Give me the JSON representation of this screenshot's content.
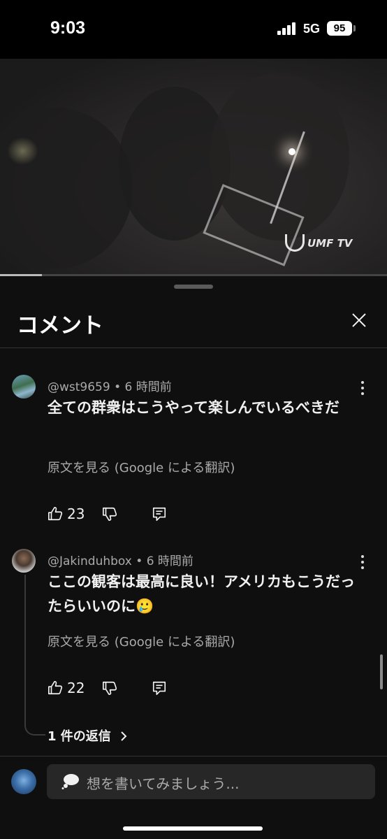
{
  "status_bar": {
    "time": "9:03",
    "network": "5G",
    "battery": "95"
  },
  "video": {
    "watermark": "UMF TV"
  },
  "sheet": {
    "title": "コメント"
  },
  "comments": [
    {
      "author": "@wst9659",
      "time": "6 時間前",
      "text": "全ての群衆はこうやって楽しんでいるべきだ",
      "translate_label": "原文を見る (Google による翻訳)",
      "likes": "23"
    },
    {
      "author": "@Jakinduhbox",
      "time": "6 時間前",
      "text": "ここの観客は最高に良い！アメリカもこうだったらいいのに🥲",
      "translate_label": "原文を見る (Google による翻訳)",
      "likes": "22"
    }
  ],
  "replies_label": "1 件の返信",
  "composer": {
    "placeholder": "想を書いてみましょう..."
  },
  "colors": {
    "background": "#0f0f0f",
    "text": "#f1f1f1",
    "secondary": "#aaaaaa"
  }
}
